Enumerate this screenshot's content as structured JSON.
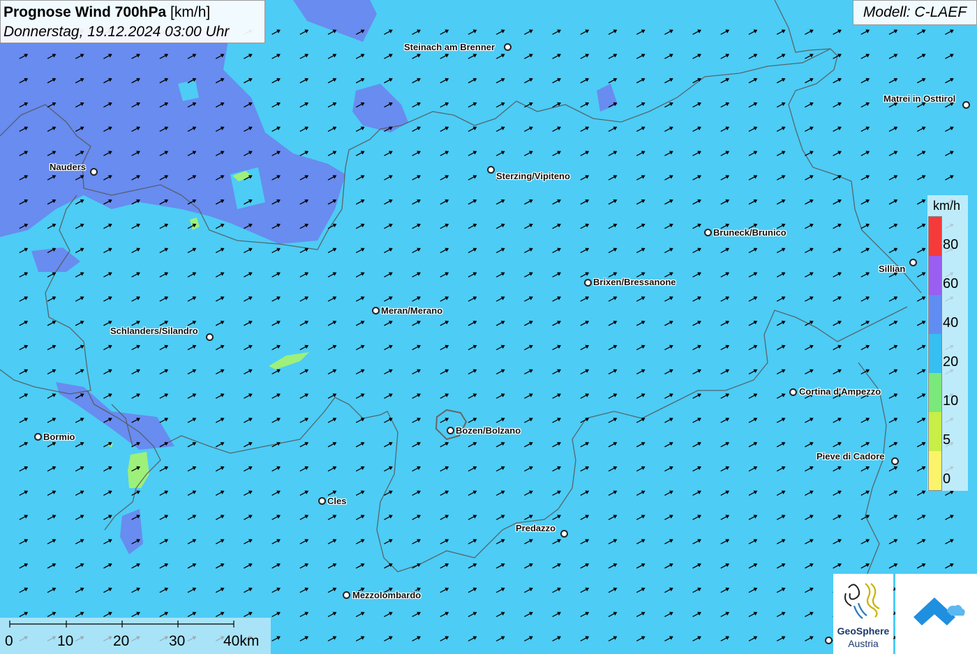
{
  "header": {
    "title_bold": "Prognose Wind 700hPa",
    "title_unit": "[km/h]",
    "subtitle": "Donnerstag, 19.12.2024 03:00 Uhr"
  },
  "model": {
    "label": "Modell: C-LAEF"
  },
  "cities": [
    {
      "name": "Steinach am Brenner"
    },
    {
      "name": "Matrei in Osttirol"
    },
    {
      "name": "Nauders"
    },
    {
      "name": "Sterzing/Vipiteno"
    },
    {
      "name": "Bruneck/Brunico"
    },
    {
      "name": "Sillian"
    },
    {
      "name": "Brixen/Bressanone"
    },
    {
      "name": "Meran/Merano"
    },
    {
      "name": "Schlanders/Silandro"
    },
    {
      "name": "Cortina d'Ampezzo"
    },
    {
      "name": "Bozen/Bolzano"
    },
    {
      "name": "Bormio"
    },
    {
      "name": "Pieve di Cadore"
    },
    {
      "name": "Cles"
    },
    {
      "name": "Predazzo"
    },
    {
      "name": "Mezzolombardo"
    }
  ],
  "legend": {
    "unit": "km/h",
    "labels": [
      "80",
      "60",
      "40",
      "20",
      "10",
      "5",
      "0"
    ],
    "colors": [
      "#f53a3a",
      "#9a5ef0",
      "#5f8df2",
      "#36bff0",
      "#7be87b",
      "#c8ee48",
      "#fbf46a"
    ]
  },
  "scale_bar": {
    "labels": [
      "0",
      "10",
      "20",
      "30",
      "40km"
    ]
  },
  "logos": {
    "geosphere_name": "GeoSphere",
    "geosphere_country": "Austria"
  },
  "colors": {
    "sea_cyan": "#4dccf5",
    "wind_purple_blue": "#6d86ee",
    "wind_green": "#9df07a",
    "arrows": "#000000",
    "borders": "#555555"
  }
}
